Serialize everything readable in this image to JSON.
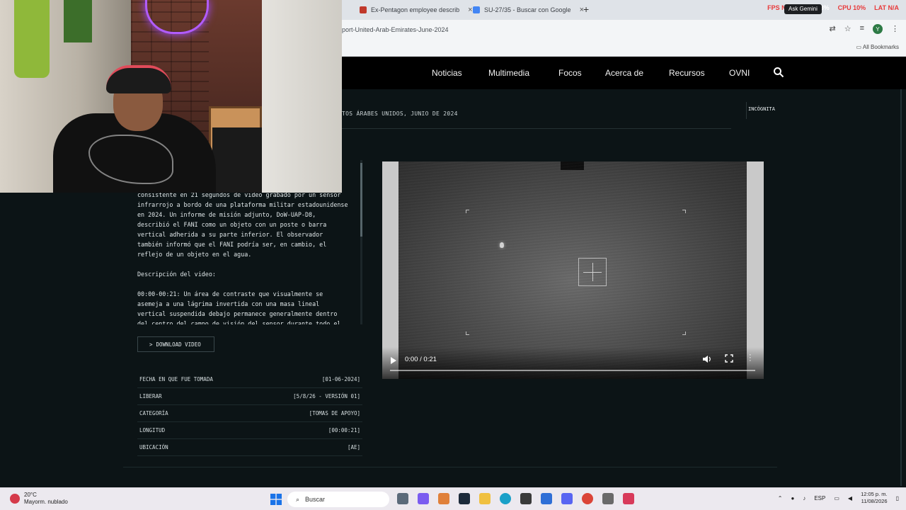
{
  "browser": {
    "tabs": [
      {
        "title": "Ex-Pentagon employee describ",
        "favicon_color": "#c0392b"
      },
      {
        "title": "SU-27/35 - Buscar con Google",
        "favicon_color": "#4285f4"
      }
    ],
    "new_tab": "+",
    "hud": {
      "fps": "FPS N/A",
      "gpu": "GPU 58%",
      "cpu": "CPU 10%",
      "lat": "LAT N/A"
    },
    "gemini_label": "Ask Gemini",
    "url": "port-United-Arab-Emirates-June-2024",
    "profile_initial": "Y",
    "bookmarks_label": "All Bookmarks"
  },
  "site_nav": {
    "items": [
      "Noticias",
      "Multimedia",
      "Focos",
      "Acerca de",
      "Recursos",
      "OVNI"
    ]
  },
  "page": {
    "breadcrumb": "TOS ÁRABES UNIDOS, JUNIO DE 2024",
    "incognita": "INCÓGNITA",
    "description": "rme\nina\n,\nconsistente en 21 segundos de video grabado por un sensor\ninfrarrojo a bordo de una plataforma militar estadounidense\nen 2024. Un informe de misión adjunto, DoW-UAP-D8,\ndescribió el FANI como un objeto con un poste o barra\nvertical adherida a su parte inferior. El observador\ntambién informó que el FANI podría ser, en cambio, el\nreflejo de un objeto en el agua.\n\nDescripción del video:\n\n00:00-00:21: Un área de contraste que visualmente se\nasemeja a una lágrima invertida con una masa lineal\nvertical suspendida debajo permanece generalmente dentro\ndel centro del campo de visión del sensor durante todo el",
    "download_label": "DOWNLOAD VIDEO",
    "download_chevron": ">",
    "metadata": [
      {
        "label": "FECHA EN QUE FUE TOMADA",
        "value": "[01-06-2024]"
      },
      {
        "label": "LIBERAR",
        "value": "[5/8/26 - VERSIÓN 01]"
      },
      {
        "label": "CATEGORÍA",
        "value": "[TOMAS DE APOYO]"
      },
      {
        "label": "LONGITUD",
        "value": "[00:00:21]"
      },
      {
        "label": "UBICACIÓN",
        "value": "[AE]"
      }
    ]
  },
  "video": {
    "time": "0:00 / 0:21",
    "progress": 0
  },
  "taskbar": {
    "weather_temp": "20°C",
    "weather_desc": "Mayorm. nublado",
    "search_label": "Buscar",
    "language": "ESP",
    "time": "12:05 p. m.",
    "date": "11/08/2026"
  }
}
